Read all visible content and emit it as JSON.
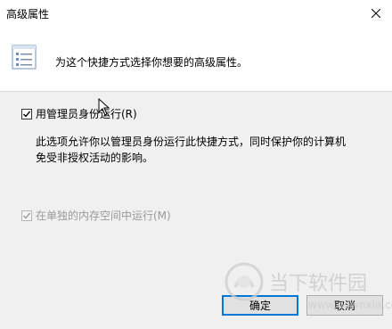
{
  "window": {
    "title": "高级属性",
    "close_icon": "close-icon"
  },
  "header": {
    "icon": "properties-list-icon",
    "text": "为这个快捷方式选择你想要的高级属性。"
  },
  "options": {
    "run_as_admin": {
      "label": "用管理员身份运行(R)",
      "checked": true,
      "enabled": true
    },
    "description_line1": "此选项允许你以管理员身份运行此快捷方式，同时保护你的计算机",
    "description_line2": "免受非授权活动的影响。",
    "separate_memory": {
      "label": "在单独的内存空间中运行(M)",
      "checked": true,
      "enabled": false
    }
  },
  "buttons": {
    "ok_label": "确定",
    "cancel_label": "取消"
  },
  "watermark": {
    "text_cn": "当下软件园",
    "text_en": "www.downxia.com"
  },
  "colors": {
    "accent": "#0078d7",
    "window_bg": "#f0f0f0",
    "header_bg": "#ffffff"
  }
}
